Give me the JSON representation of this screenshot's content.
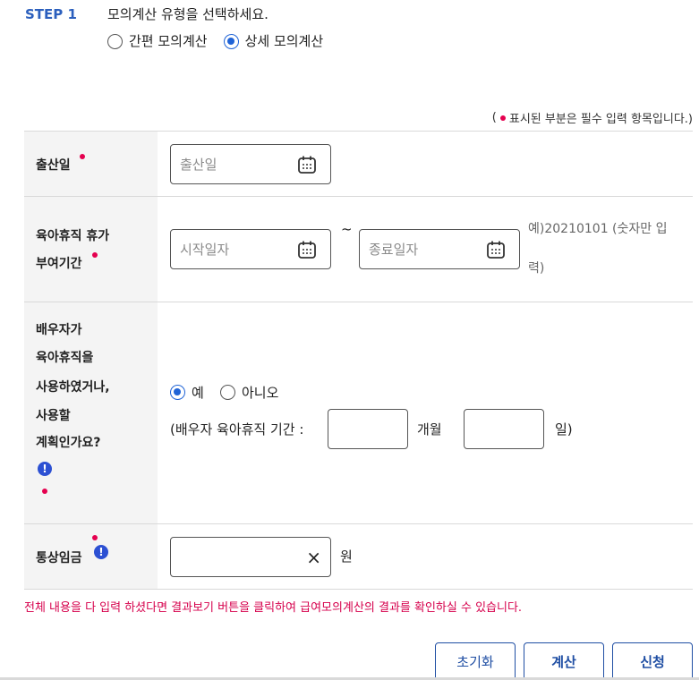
{
  "step": {
    "label": "STEP 1",
    "question": "모의계산 유형을 선택하세요.",
    "options": [
      {
        "label": "간편 모의계산",
        "selected": false
      },
      {
        "label": "상세 모의계산",
        "selected": true
      }
    ]
  },
  "required_note": {
    "open": "(",
    "text": "표시된 부분은 필수 입력 항목입니다.)"
  },
  "birth": {
    "label": "출산일",
    "placeholder": "출산일"
  },
  "leave": {
    "label_line1": "육아휴직 휴가",
    "label_line2": "부여기간",
    "start_placeholder": "시작일자",
    "separator": "~",
    "end_placeholder": "종료일자",
    "hint_line1": "예)20210101 (숫자만 입",
    "hint_line2": "력)"
  },
  "spouse": {
    "label_lines": [
      "배우자가",
      "육아휴직을",
      "사용하였거나,",
      "사용할",
      "계획인가요?"
    ],
    "info_icon": "!",
    "options": [
      {
        "label": "예",
        "selected": true
      },
      {
        "label": "아니오",
        "selected": false
      }
    ],
    "period_prefix": "(배우자 육아휴직 기간 :",
    "months_unit": "개월",
    "days_unit": "일)"
  },
  "wage": {
    "label": "통상임금",
    "info_icon": "!",
    "clear_icon": "×",
    "unit": "원"
  },
  "notice": "전체 내용을 다 입력 하셨다면 결과보기 버튼을 클릭하여 급여모의계산의 결과를 확인하실 수 있습니다.",
  "buttons": {
    "reset": "초기화",
    "calculate": "계산",
    "apply": "신청"
  },
  "colors": {
    "accent": "#1f63d6",
    "required": "#e5004f",
    "notice": "#d6004c",
    "button": "#1f4ea3"
  }
}
